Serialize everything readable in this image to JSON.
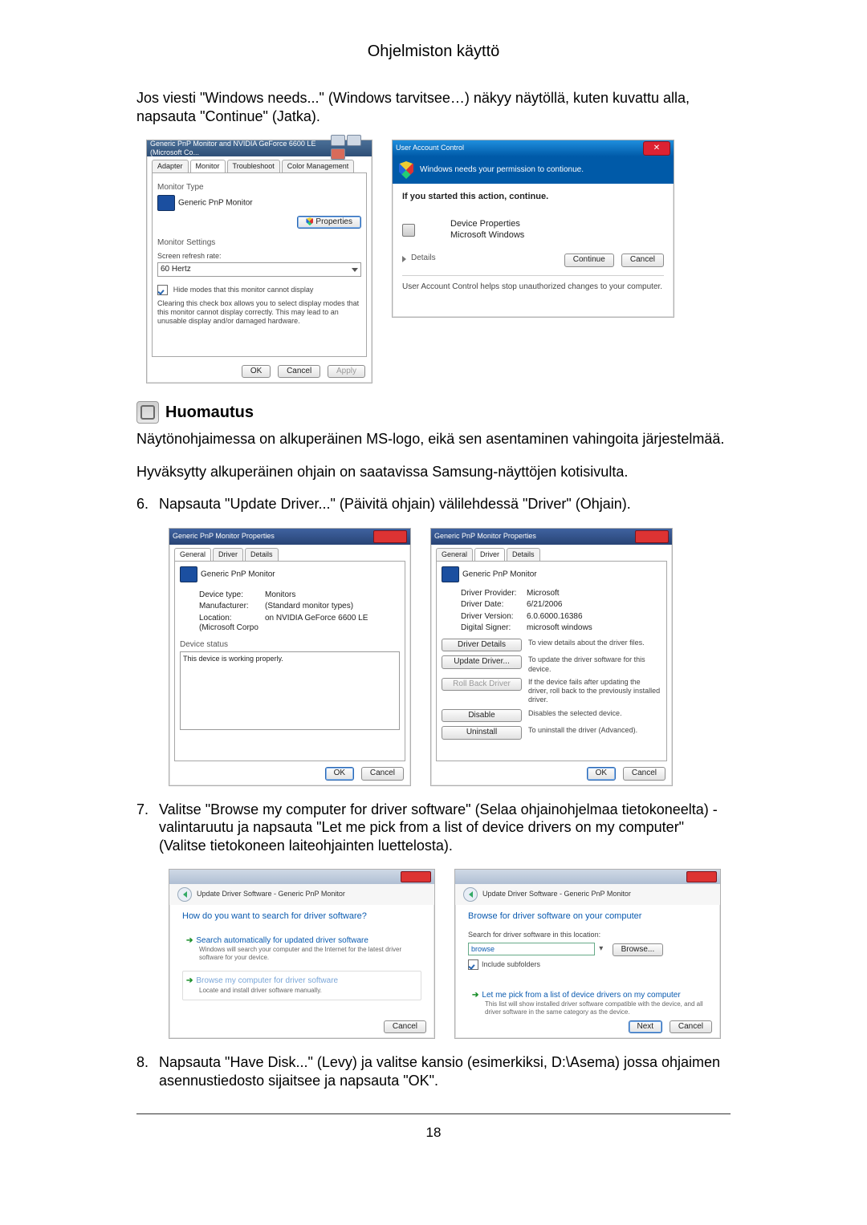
{
  "page": {
    "section_title": "Ohjelmiston käyttö",
    "intro": "Jos viesti \"Windows needs...\" (Windows tarvitsee…) näkyy näytöllä, kuten kuvattu alla, napsauta \"Continue\" (Jatka).",
    "note_heading": "Huomautus",
    "note_p1": "Näytönohjaimessa on alkuperäinen MS-logo, eikä sen asentaminen vahingoita järjestelmää.",
    "note_p2": "Hyväksytty alkuperäinen ohjain on saatavissa Samsung-näyttöjen kotisivulta.",
    "step6_num": "6.",
    "step6": "Napsauta \"Update Driver...\" (Päivitä ohjain) välilehdessä \"Driver\" (Ohjain).",
    "step7_num": "7.",
    "step7": "Valitse \"Browse my computer for driver software\" (Selaa ohjainohjelmaa tietokoneelta) -valintaruutu ja napsauta \"Let me pick from a list of device drivers on my computer\" (Valitse tietokoneen laiteohjainten luettelosta).",
    "step8_num": "8.",
    "step8": "Napsauta \"Have Disk...\" (Levy) ja valitse kansio (esimerkiksi, D:\\Asema) jossa ohjaimen asennustiedosto sijaitsee ja napsauta \"OK\".",
    "page_number": "18"
  },
  "monitor_dialog": {
    "title": "Generic PnP Monitor and NVIDIA GeForce 6600 LE (Microsoft Co...",
    "tabs": {
      "adapter": "Adapter",
      "monitor": "Monitor",
      "troubleshoot": "Troubleshoot",
      "color": "Color Management"
    },
    "group_type": "Monitor Type",
    "device": "Generic PnP Monitor",
    "properties_btn": "Properties",
    "group_settings": "Monitor Settings",
    "refresh_label": "Screen refresh rate:",
    "refresh_value": "60 Hertz",
    "hide_modes": "Hide modes that this monitor cannot display",
    "hide_desc": "Clearing this check box allows you to select display modes that this monitor cannot display correctly. This may lead to an unusable display and/or damaged hardware.",
    "ok": "OK",
    "cancel": "Cancel",
    "apply": "Apply"
  },
  "uac": {
    "title": "User Account Control",
    "need": "Windows needs your permission to contionue.",
    "started": "If you started this action, continue.",
    "prop_line1": "Device Properties",
    "prop_line2": "Microsoft Windows",
    "details": "Details",
    "continue": "Continue",
    "cancel": "Cancel",
    "footer": "User Account Control helps stop unauthorized changes to your computer."
  },
  "prop_general": {
    "title": "Generic PnP Monitor Properties",
    "tabs": {
      "general": "General",
      "driver": "Driver",
      "details": "Details"
    },
    "device": "Generic PnP Monitor",
    "k_type": "Device type:",
    "v_type": "Monitors",
    "k_mfg": "Manufacturer:",
    "v_mfg": "(Standard monitor types)",
    "k_loc": "Location:",
    "v_loc": "on NVIDIA GeForce 6600 LE (Microsoft Corpo",
    "status_label": "Device status",
    "status_text": "This device is working properly.",
    "ok": "OK",
    "cancel": "Cancel"
  },
  "prop_driver": {
    "title": "Generic PnP Monitor Properties",
    "device": "Generic PnP Monitor",
    "k_prov": "Driver Provider:",
    "v_prov": "Microsoft",
    "k_date": "Driver Date:",
    "v_date": "6/21/2006",
    "k_ver": "Driver Version:",
    "v_ver": "6.0.6000.16386",
    "k_sign": "Digital Signer:",
    "v_sign": "microsoft windows",
    "btn_details": "Driver Details",
    "d_details": "To view details about the driver files.",
    "btn_update": "Update Driver...",
    "d_update": "To update the driver software for this device.",
    "btn_rollback": "Roll Back Driver",
    "d_rollback": "If the device fails after updating the driver, roll back to the previously installed driver.",
    "btn_disable": "Disable",
    "d_disable": "Disables the selected device.",
    "btn_uninstall": "Uninstall",
    "d_uninstall": "To uninstall the driver (Advanced).",
    "ok": "OK",
    "cancel": "Cancel"
  },
  "wiz_search": {
    "nav": "Update Driver Software - Generic PnP Monitor",
    "heading": "How do you want to search for driver software?",
    "opt1": "Search automatically for updated driver software",
    "opt1_sub": "Windows will search your computer and the Internet for the latest driver software for your device.",
    "opt2": "Browse my computer for driver software",
    "opt2_sub": "Locate and install driver software manually.",
    "cancel": "Cancel"
  },
  "wiz_browse": {
    "nav": "Update Driver Software - Generic PnP Monitor",
    "heading": "Browse for driver software on your computer",
    "search_label": "Search for driver software in this location:",
    "path": "browse",
    "browse": "Browse...",
    "include": "Include subfolders",
    "pick": "Let me pick from a list of device drivers on my computer",
    "pick_sub": "This list will show installed driver software compatible with the device, and all driver software in the same category as the device.",
    "next": "Next",
    "cancel": "Cancel"
  }
}
